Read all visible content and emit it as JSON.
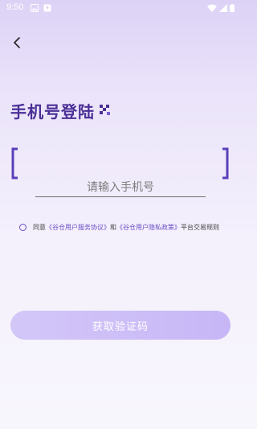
{
  "status_bar": {
    "time": "9:50"
  },
  "header": {
    "back_icon": "chevron-left-icon"
  },
  "login": {
    "title": "手机号登陆",
    "phone_placeholder": "请输入手机号",
    "phone_value": ""
  },
  "agreement": {
    "prefix": "同意",
    "user_agreement": "《谷仓用户服务协议》",
    "conjunction": "和",
    "privacy_policy": "《谷仓用户隐私政策》",
    "suffix": "平台交易规则"
  },
  "actions": {
    "get_code_label": "获取验证码"
  },
  "colors": {
    "accent": "#4a2f96",
    "link": "#6a4dc8",
    "button_start": "#d3c7f8",
    "button_end": "#c7b6f6"
  }
}
